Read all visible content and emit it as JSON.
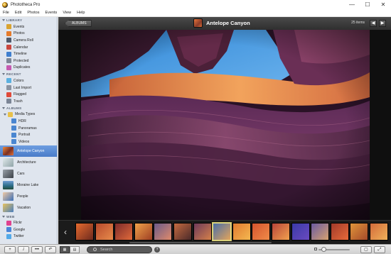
{
  "window": {
    "title": "Phototheca Pro",
    "controls": [
      "—",
      "☐",
      "✕"
    ]
  },
  "menu": [
    "File",
    "Edit",
    "Photos",
    "Events",
    "View",
    "Help"
  ],
  "sidebar": {
    "library_header": "LIBRARY",
    "library": [
      {
        "label": "Events",
        "icon": "events-icon",
        "color": "#d9a330"
      },
      {
        "label": "Photos",
        "icon": "photos-icon",
        "color": "#e57b2c"
      },
      {
        "label": "Camera Roll",
        "icon": "camera-roll-icon",
        "color": "#4e5a6c"
      },
      {
        "label": "Calendar",
        "icon": "calendar-icon",
        "color": "#c9473f"
      },
      {
        "label": "Timeline",
        "icon": "timeline-icon",
        "color": "#3f7fcf"
      },
      {
        "label": "Protected",
        "icon": "protected-icon",
        "color": "#7d8796"
      },
      {
        "label": "Duplicates",
        "icon": "duplicates-icon",
        "color": "#c55ab0"
      }
    ],
    "recent_header": "RECENT",
    "recent": [
      {
        "label": "Colors",
        "icon": "colors-icon",
        "color": "#5ab0e0"
      },
      {
        "label": "Last Import",
        "icon": "last-import-icon",
        "color": "#8a92a0"
      },
      {
        "label": "Flagged",
        "icon": "flagged-icon",
        "color": "#e04a3a"
      },
      {
        "label": "Trash",
        "icon": "trash-icon",
        "color": "#7b8595"
      }
    ],
    "albums_header": "ALBUMS",
    "media_types": {
      "label": "Media Types",
      "icon": "folder-icon",
      "color": "#e8c14a"
    },
    "media": [
      {
        "label": "HDR",
        "icon": "hdr-icon",
        "color": "#4a86d0"
      },
      {
        "label": "Panoramas",
        "icon": "panoramas-icon",
        "color": "#4a86d0"
      },
      {
        "label": "Portrait",
        "icon": "portrait-icon",
        "color": "#4a86d0"
      },
      {
        "label": "Videos",
        "icon": "videos-icon",
        "color": "#4a86d0"
      }
    ],
    "albums": [
      {
        "label": "Antelope Canyon",
        "thumb": "linear-gradient(135deg,#f08a3a,#7a2f22 55%,#e3733a)",
        "selected": true
      },
      {
        "label": "Architecture",
        "thumb": "linear-gradient(135deg,#dfe8ea,#8fa4a8)"
      },
      {
        "label": "Cars",
        "thumb": "linear-gradient(135deg,#9aa2aa,#3a3f46)"
      },
      {
        "label": "Moraine Lake",
        "thumb": "linear-gradient(180deg,#6f9bd0,#2d6e8a 55%,#234c3a)"
      },
      {
        "label": "People",
        "thumb": "linear-gradient(135deg,#f1c9a3,#3b6fb6)"
      },
      {
        "label": "Vacation",
        "thumb": "linear-gradient(135deg,#e7c25d,#4a7fbf)"
      }
    ],
    "web_header": "WEB",
    "web": [
      {
        "label": "Flickr",
        "icon": "flickr-icon",
        "color": "#e0428f"
      },
      {
        "label": "Google",
        "icon": "google-icon",
        "color": "#4a85d8"
      },
      {
        "label": "Twitter",
        "icon": "twitter-icon",
        "color": "#53a9e8"
      }
    ]
  },
  "toolbar": {
    "albums_label": "ALBUMS",
    "album_title": "Antelope Canyon",
    "items_count": "25 items",
    "prev": "◀",
    "next": "▶"
  },
  "filmstrip": {
    "prev": "‹",
    "next": "›",
    "thumbs": [
      "linear-gradient(135deg,#e66a2f,#6d2a1e)",
      "linear-gradient(135deg,#b74a2c,#e78b4b)",
      "linear-gradient(135deg,#7d2b2b,#e06a3a)",
      "linear-gradient(135deg,#f0a24a,#9d3f23)",
      "linear-gradient(135deg,#6a5b8a,#e08a6a)",
      "linear-gradient(135deg,#c46a40,#4b2a2a)",
      "linear-gradient(135deg,#6d3a5a,#d5804a)",
      "linear-gradient(135deg,#4a6fa8,#e3a45a)",
      "linear-gradient(135deg,#e07a30,#f4b850)",
      "linear-gradient(135deg,#d4542e,#f08b48)",
      "linear-gradient(135deg,#b8443a,#f2a14e)",
      "linear-gradient(135deg,#3a3aa8,#6a4ac0)",
      "linear-gradient(135deg,#6a5aa0,#d7a270)",
      "linear-gradient(135deg,#a03a2a,#e86a3a)",
      "linear-gradient(135deg,#e0943a,#a44a2a)",
      "linear-gradient(135deg,#d36a3a,#f0b25a)"
    ],
    "selected_index": 7
  },
  "bottombar": {
    "add": "+",
    "info": "i",
    "more": "•••",
    "rotate": "↶",
    "search_placeholder": "Search",
    "help": "?",
    "fit": "▢",
    "fullscreen": "⤢"
  }
}
